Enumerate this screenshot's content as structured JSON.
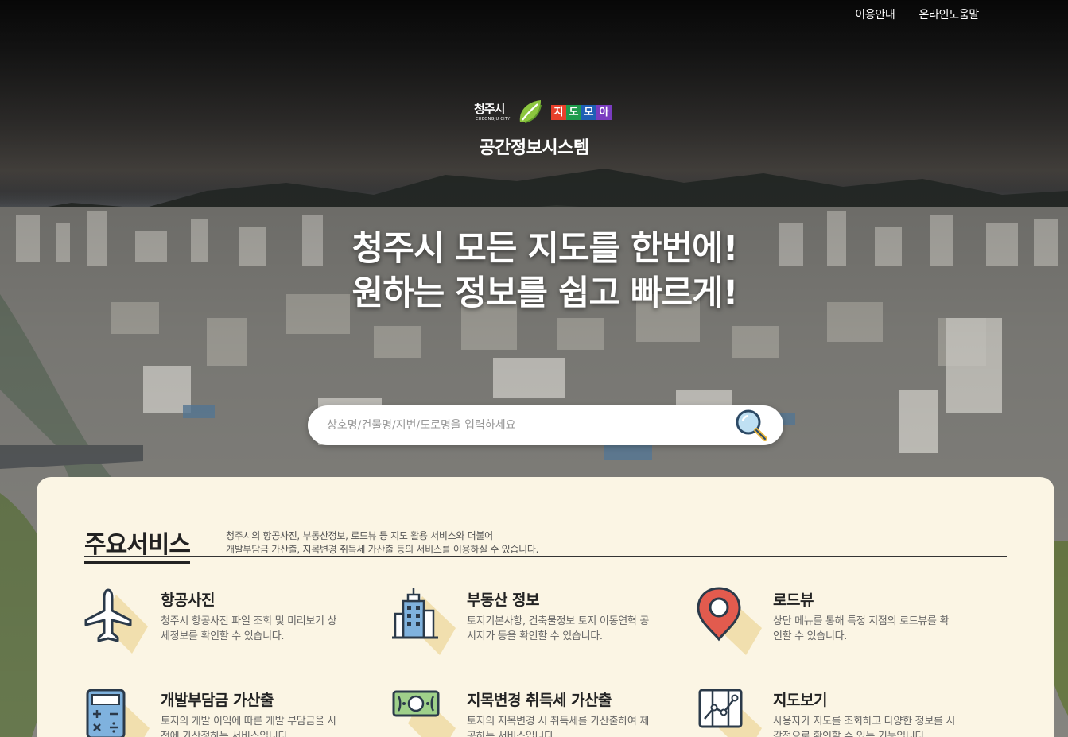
{
  "nav": {
    "guide": "이용안내",
    "help": "온라인도움말"
  },
  "brand": {
    "city": "청주시",
    "city_en": "CHEONGJU CITY",
    "jido": [
      "지",
      "도",
      "모",
      "아"
    ],
    "jido_colors": [
      "#e8402b",
      "#1e9b4c",
      "#1f5fb5",
      "#7a3cc0"
    ],
    "system_title": "공간정보시스템"
  },
  "headline": {
    "line1": "청주시 모든 지도를 한번에!",
    "line2": "원하는 정보를 쉽고 빠르게!"
  },
  "search": {
    "placeholder": "상호명/건물명/지번/도로명을 입력하세요",
    "value": "",
    "icon": "search-icon"
  },
  "services": {
    "title": "주요서비스",
    "desc_line1": "청주시의 항공사진, 부동산정보, 로드뷰 등 지도 활용 서비스와 더불어",
    "desc_line2": "개발부담금 가산출, 지목변경 취득세 가산출 등의 서비스를 이용하실 수 있습니다.",
    "items": [
      {
        "title": "항공사진",
        "desc": "청주시 항공사진 파일 조회 및 미리보기 상세정보를 확인할 수 있습니다.",
        "icon": "airplane-icon"
      },
      {
        "title": "부동산 정보",
        "desc": "토지기본사항, 건축물정보 토지 이동연혁 공시지가 등을 확인할 수 있습니다.",
        "icon": "building-icon"
      },
      {
        "title": "로드뷰",
        "desc": "상단 메뉴를 통해 특정 지점의 로드뷰를 확인할 수 있습니다.",
        "icon": "map-pin-icon"
      },
      {
        "title": "개발부담금 가산출",
        "desc": "토지의 개발 이익에 따른 개발 부담금을 사전에 가산정하는 서비스입니다.",
        "icon": "calculator-icon"
      },
      {
        "title": "지목변경 취득세 가산출",
        "desc": "토지의 지목변경 시 취득세를 가산출하여 제공하는 서비스입니다.",
        "icon": "money-icon"
      },
      {
        "title": "지도보기",
        "desc": "사용자가 지도를 조회하고 다양한 정보를 시각적으로 확인할 수 있는 기능입니다.",
        "icon": "map-icon"
      }
    ]
  },
  "colors": {
    "panel_bg": "#fbf5e4",
    "icon_shadow": "#f1dfae",
    "icon_dark": "#2b3a4a",
    "icon_blue": "#7fb2de",
    "pin_red": "#e25b4e"
  }
}
